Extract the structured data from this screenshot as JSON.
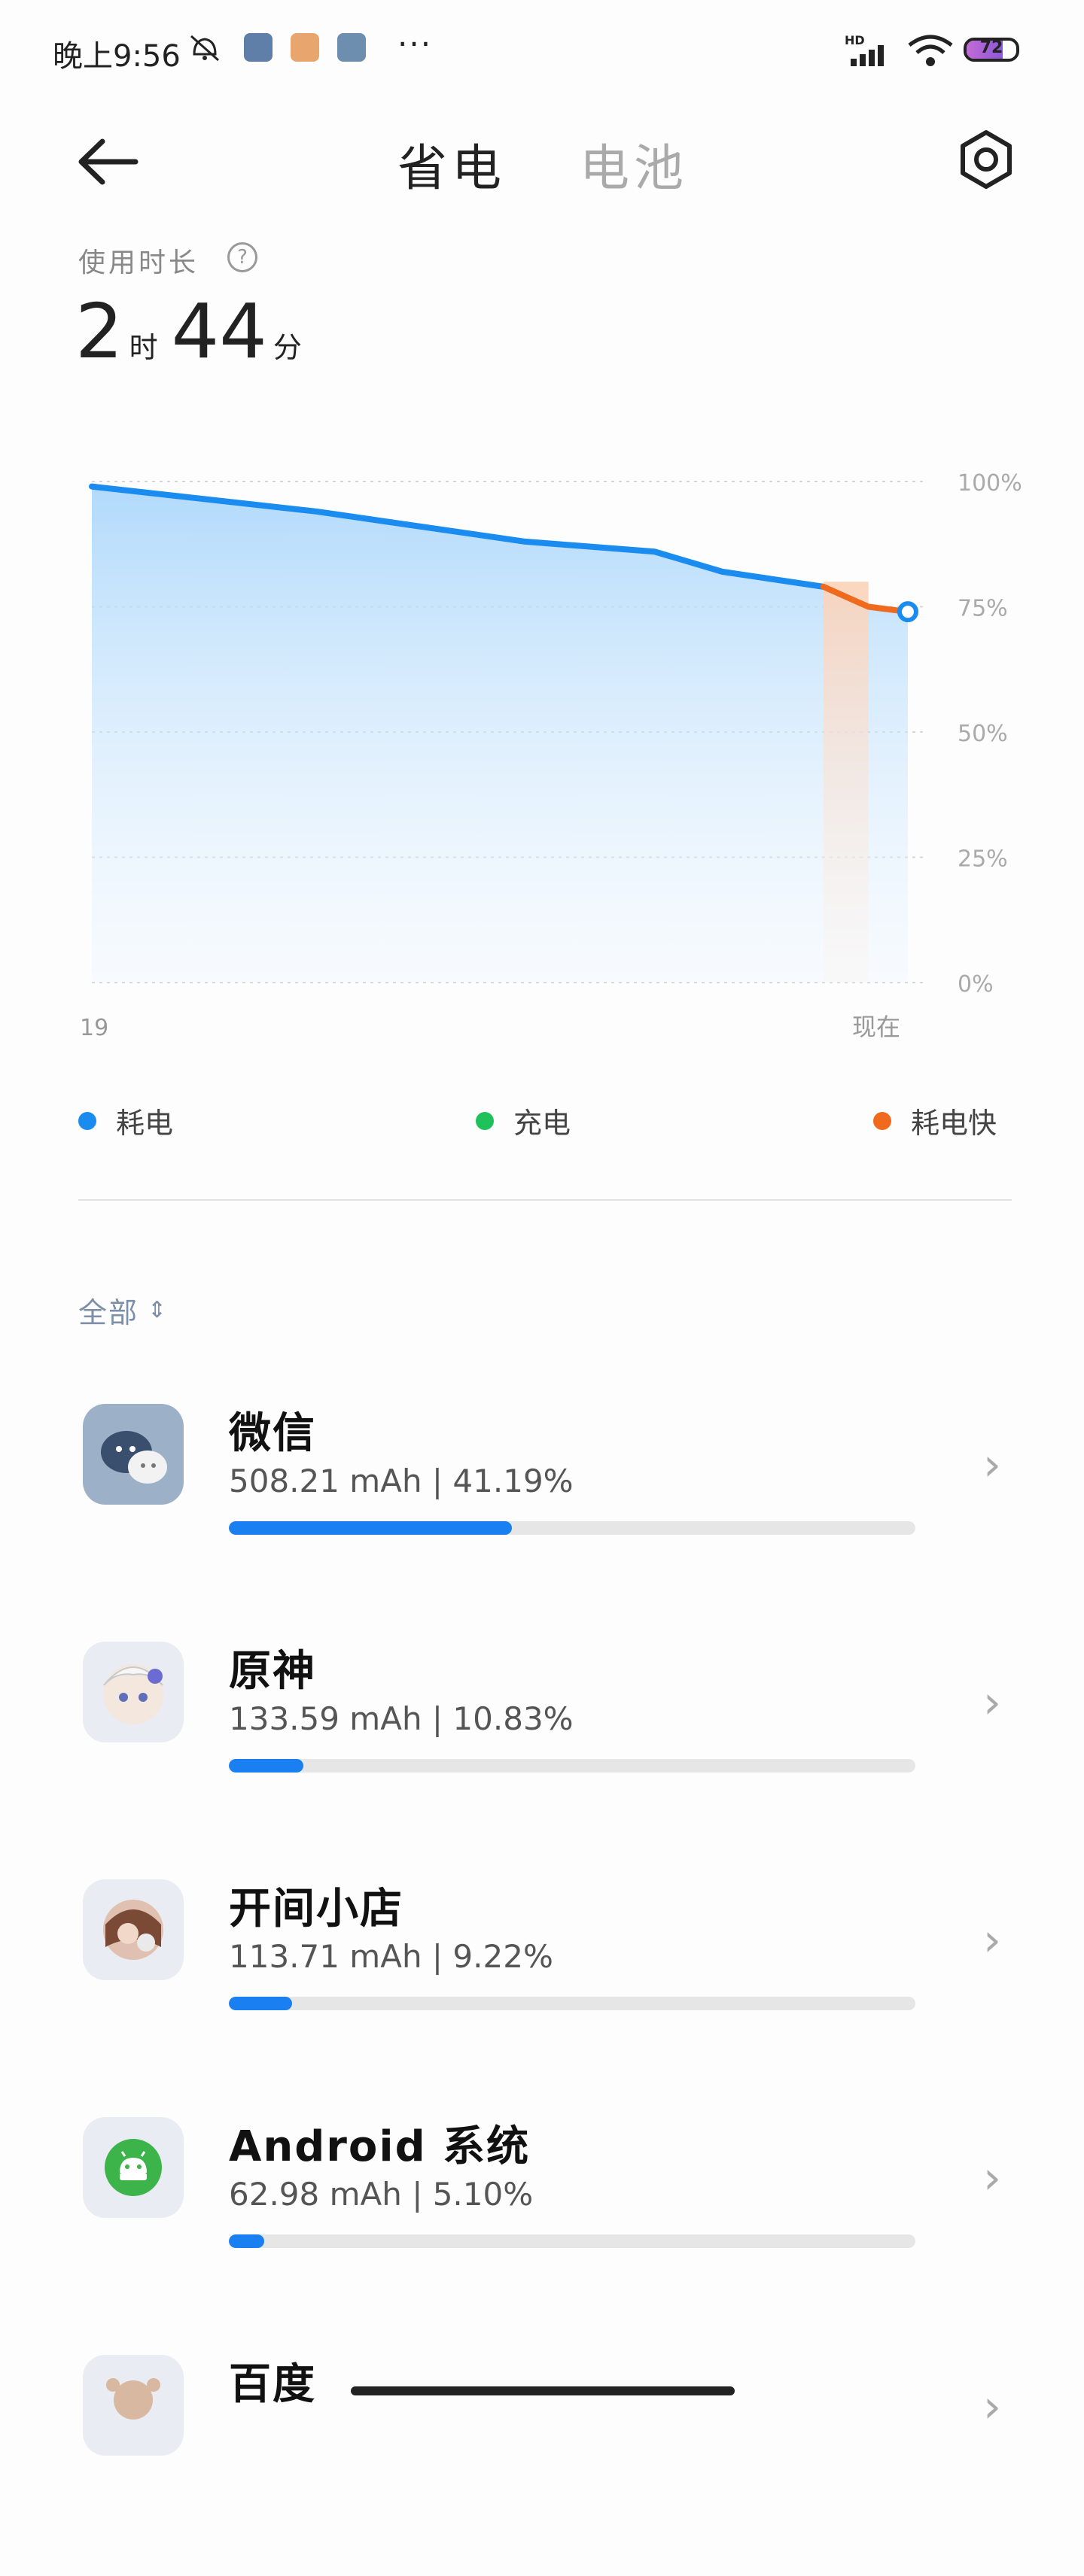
{
  "status_bar": {
    "time": "晚上9:56",
    "dots": "···",
    "network_label": "HD",
    "battery_level": "72",
    "icons": [
      "mute-icon",
      "app-icon-1",
      "app-icon-2",
      "app-icon-3",
      "signal-icon",
      "wifi-icon",
      "battery-icon"
    ]
  },
  "header": {
    "tab_save": "省电",
    "tab_battery": "电池",
    "back_icon": "back-arrow-icon",
    "settings_icon": "settings-icon"
  },
  "usage": {
    "label": "使用时长",
    "hours": "2",
    "hours_unit": "时",
    "minutes": "44",
    "minutes_unit": "分"
  },
  "chart_data": {
    "type": "area",
    "x_labels": [
      "19",
      "现在"
    ],
    "y_ticks": [
      "100%",
      "75%",
      "50%",
      "25%",
      "0%"
    ],
    "ylim": [
      0,
      100
    ],
    "series": [
      {
        "name": "耗电",
        "color": "#1a8cf0",
        "points": [
          [
            0,
            99
          ],
          [
            0.4,
            94
          ],
          [
            0.77,
            88
          ],
          [
            1.0,
            86
          ],
          [
            1.12,
            82
          ],
          [
            1.3,
            79
          ]
        ]
      },
      {
        "name": "耗电快",
        "color": "#f06a1e",
        "points": [
          [
            1.3,
            79
          ],
          [
            1.38,
            75
          ],
          [
            1.45,
            74
          ]
        ]
      }
    ],
    "x_range": [
      0,
      1.45
    ],
    "fast_drain_band": [
      1.3,
      1.38
    ],
    "legend": [
      "耗电",
      "充电",
      "耗电快"
    ],
    "legend_colors": [
      "#1a8cf0",
      "#1fc15a",
      "#f06a1e"
    ],
    "grid": true
  },
  "filter": {
    "label": "全部",
    "icon": "sort-chevron-icon"
  },
  "apps": [
    {
      "name": "微信",
      "stat": "508.21 mAh | 41.19%",
      "percent": 41.19
    },
    {
      "name": "原神",
      "stat": "133.59 mAh | 10.83%",
      "percent": 10.83
    },
    {
      "name": "开间小店",
      "stat": "113.71 mAh | 9.22%",
      "percent": 9.22
    },
    {
      "name": "Android 系统",
      "stat": "62.98 mAh | 5.10%",
      "percent": 5.1
    },
    {
      "name": "百度",
      "stat": "",
      "percent": null
    }
  ],
  "colors": {
    "accent_blue": "#1a7ff0",
    "charge_green": "#1fc15a",
    "drain_orange": "#f06a1e"
  }
}
